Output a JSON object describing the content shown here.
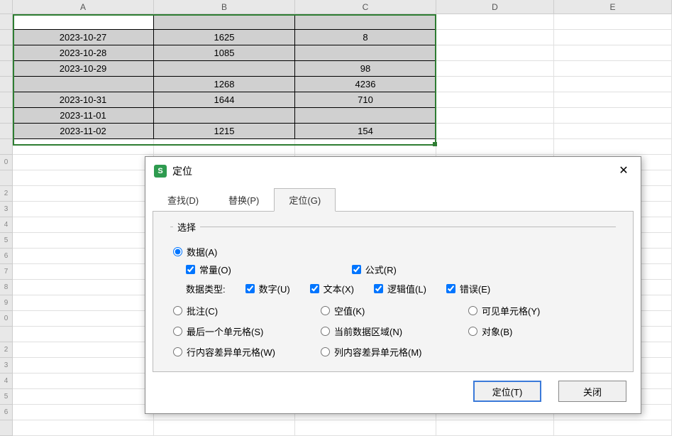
{
  "columns": [
    "A",
    "B",
    "C",
    "D",
    "E"
  ],
  "row_numbers": [
    "",
    "",
    "",
    "",
    "",
    "",
    "",
    "",
    "",
    "0",
    "",
    "2",
    "3",
    "4",
    "5",
    "6",
    "7",
    "8",
    "9",
    "0",
    "",
    "2",
    "3",
    "4",
    "5",
    "6"
  ],
  "data_rows": [
    {
      "A": "",
      "B": "",
      "C": ""
    },
    {
      "A": "2023-10-27",
      "B": "1625",
      "C": "8"
    },
    {
      "A": "2023-10-28",
      "B": "1085",
      "C": ""
    },
    {
      "A": "2023-10-29",
      "B": "",
      "C": "98"
    },
    {
      "A": "",
      "B": "1268",
      "C": "4236"
    },
    {
      "A": "2023-10-31",
      "B": "1644",
      "C": "710"
    },
    {
      "A": "2023-11-01",
      "B": "",
      "C": ""
    },
    {
      "A": "2023-11-02",
      "B": "1215",
      "C": "154"
    }
  ],
  "extra_rows": 19,
  "dialog": {
    "title": "定位",
    "tabs": {
      "find": "查找(D)",
      "replace": "替换(P)",
      "goto": "定位(G)"
    },
    "group_label": "选择",
    "opts": {
      "data": "数据(A)",
      "constant": "常量(O)",
      "formula": "公式(R)",
      "datatype_label": "数据类型:",
      "number": "数字(U)",
      "text": "文本(X)",
      "logic": "逻辑值(L)",
      "error": "错误(E)",
      "comment": "批注(C)",
      "blank": "空值(K)",
      "visible": "可见单元格(Y)",
      "lastcell": "最后一个单元格(S)",
      "currentregion": "当前数据区域(N)",
      "object": "对象(B)",
      "rowdiff": "行内容差异单元格(W)",
      "coldiff": "列内容差异单元格(M)"
    },
    "buttons": {
      "goto": "定位(T)",
      "close": "关闭"
    }
  }
}
